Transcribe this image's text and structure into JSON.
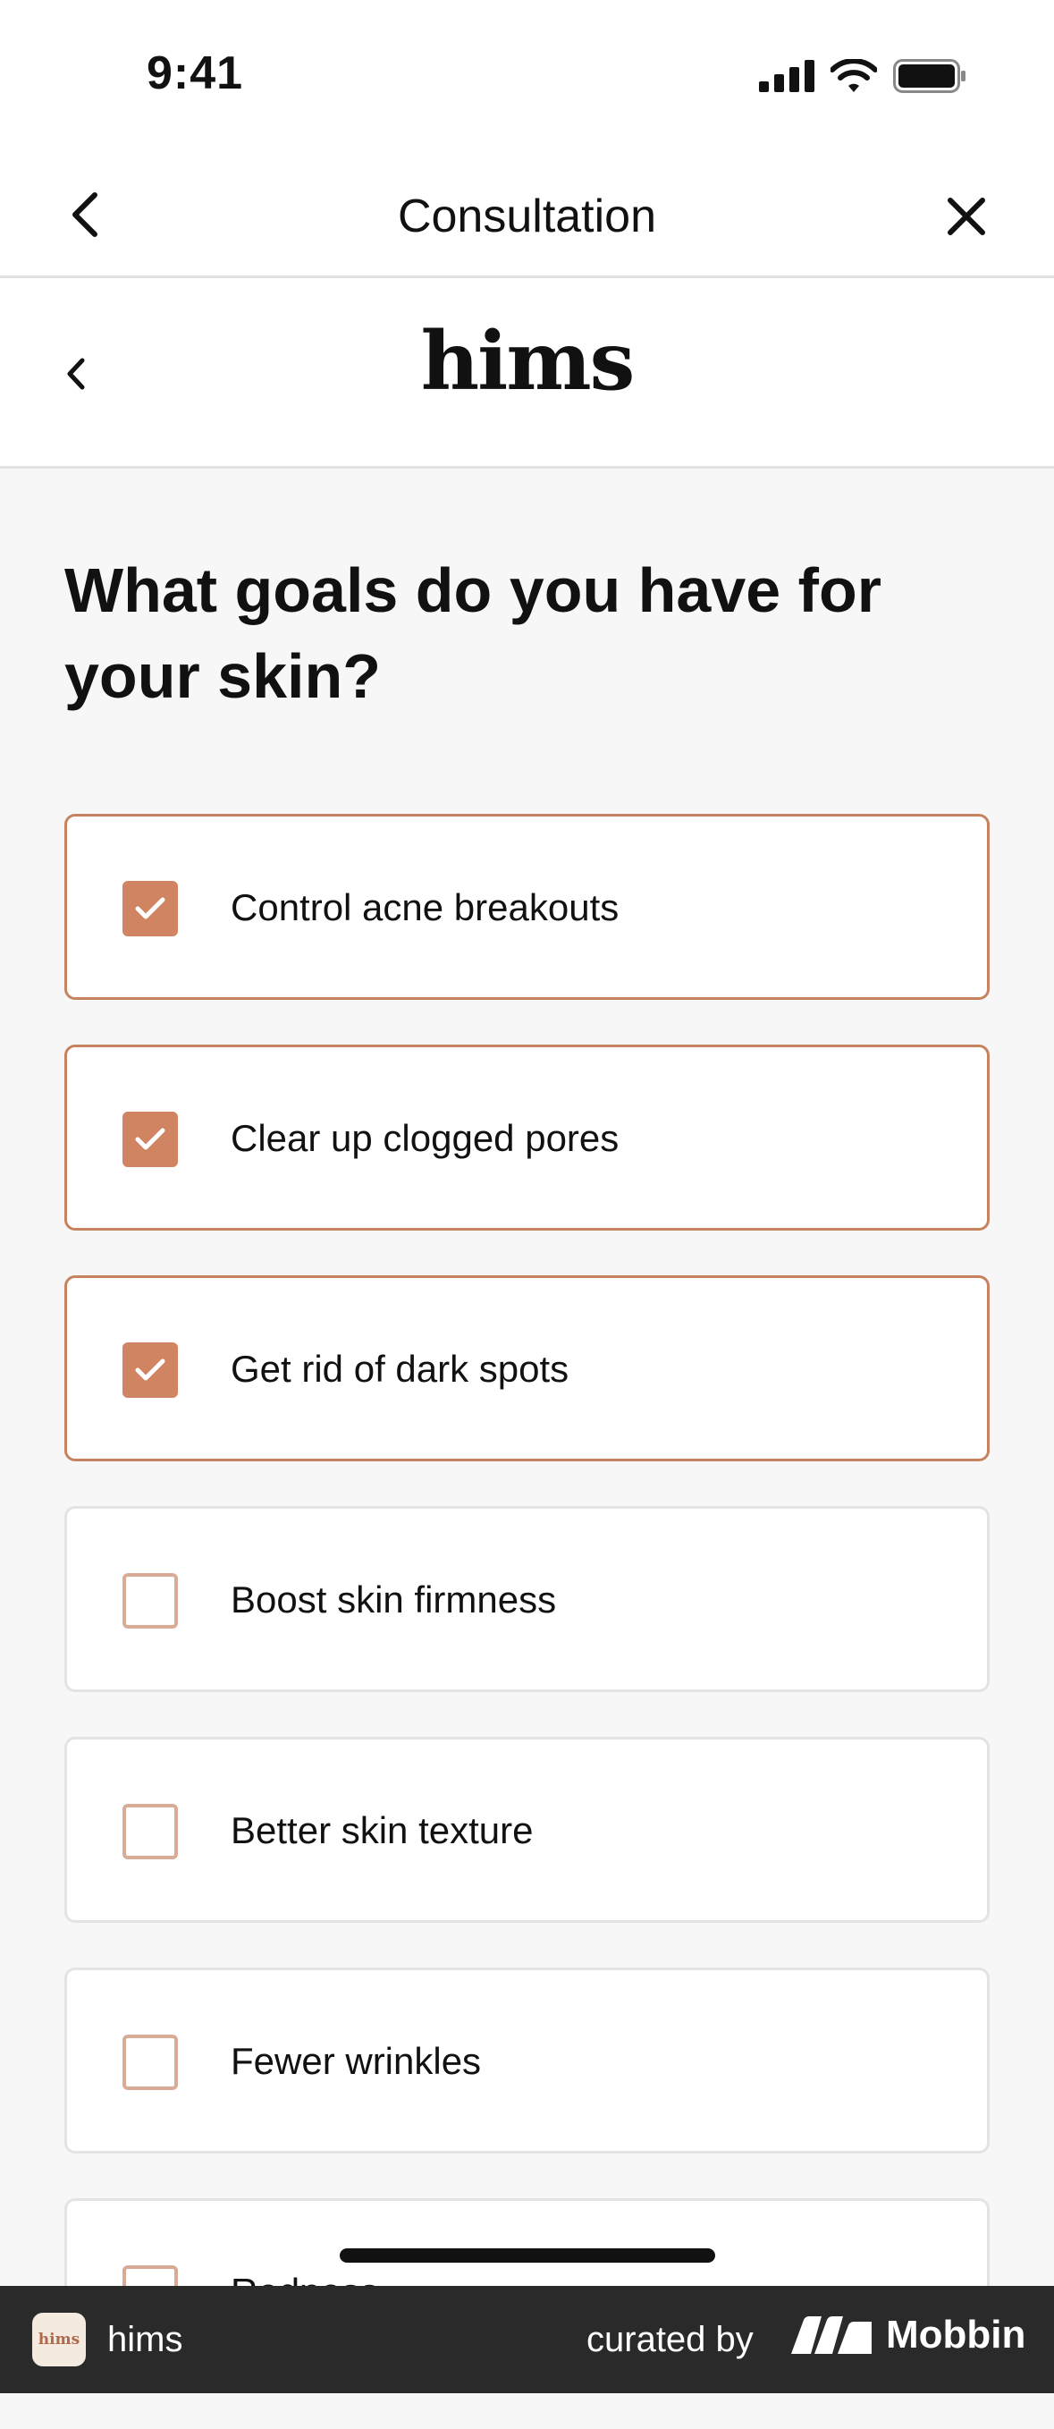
{
  "status_bar": {
    "time": "9:41"
  },
  "nav": {
    "title": "Consultation"
  },
  "brand": {
    "logo": "hims"
  },
  "question": "What goals do you have for your skin?",
  "options": [
    {
      "label": "Control acne breakouts",
      "selected": true
    },
    {
      "label": "Clear up clogged pores",
      "selected": true
    },
    {
      "label": "Get rid of dark spots",
      "selected": true
    },
    {
      "label": "Boost skin firmness",
      "selected": false
    },
    {
      "label": "Better skin texture",
      "selected": false
    },
    {
      "label": "Fewer wrinkles",
      "selected": false
    },
    {
      "label": "Redness",
      "selected": false
    }
  ],
  "footer": {
    "app_icon_text": "hims",
    "app_name": "hims",
    "curated_by": "curated by",
    "brand": "Mobbin"
  },
  "colors": {
    "accent": "#d08462",
    "accent_border": "#c7825f",
    "unchecked_border": "#d8ab97",
    "footer_bg": "#2a2a2a"
  },
  "icons": {
    "signal": "cellular-signal-icon",
    "wifi": "wifi-icon",
    "battery": "battery-icon",
    "back": "chevron-left-icon",
    "close": "close-icon",
    "check": "checkmark-icon",
    "mobbin": "mobbin-logo-icon"
  }
}
